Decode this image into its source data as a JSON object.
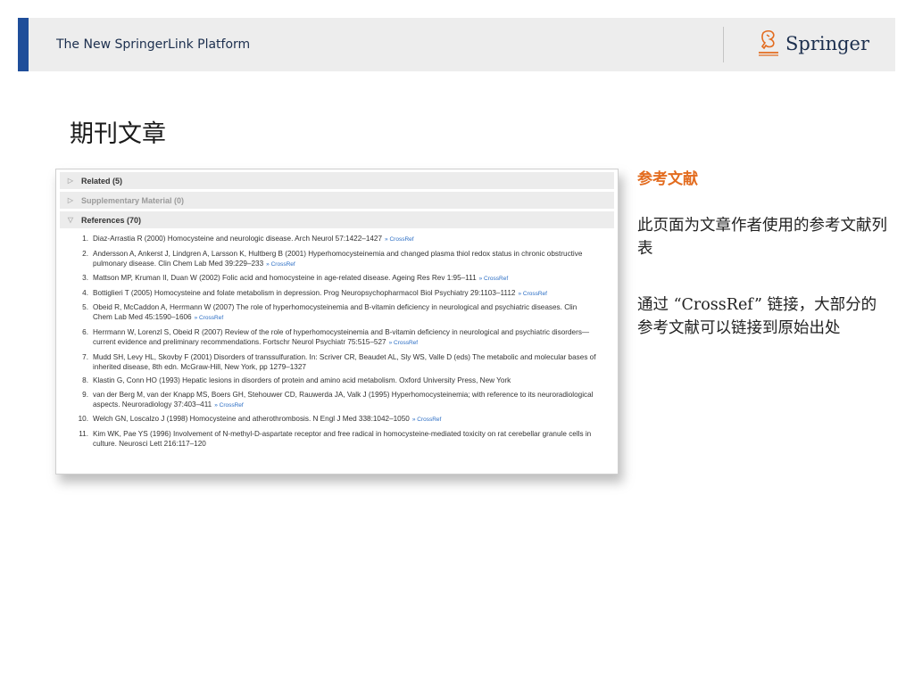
{
  "header": {
    "platform_title": "The New SpringerLink Platform",
    "brand_name": "Springer",
    "brand_icon": "springer-horse-icon",
    "accent_color": "#1f4e9a"
  },
  "page_title": "期刊文章",
  "article_panel": {
    "sections": [
      {
        "label": "Related (5)",
        "state": "collapsed"
      },
      {
        "label": "Supplementary Material (0)",
        "state": "collapsed-disabled"
      },
      {
        "label": "References (70)",
        "state": "expanded"
      }
    ],
    "crossref_label": "» CrossRef",
    "references": [
      {
        "num": "1.",
        "text": "Diaz-Arrastia R (2000) Homocysteine and neurologic disease. Arch Neurol 57:1422–1427",
        "crossref": true
      },
      {
        "num": "2.",
        "text": "Andersson A, Ankerst J, Lindgren A, Larsson K, Hultberg B (2001) Hyperhomocysteinemia and changed plasma thiol redox status in chronic obstructive pulmonary disease. Clin Chem Lab Med 39:229–233",
        "crossref": true
      },
      {
        "num": "3.",
        "text": "Mattson MP, Kruman II, Duan W (2002) Folic acid and homocysteine in age-related disease. Ageing Res Rev 1:95–111",
        "crossref": true
      },
      {
        "num": "4.",
        "text": "Bottiglieri T (2005) Homocysteine and folate metabolism in depression. Prog Neuropsychopharmacol Biol Psychiatry 29:1103–1112",
        "crossref": true
      },
      {
        "num": "5.",
        "text": "Obeid R, McCaddon A, Herrmann W (2007) The role of hyperhomocysteinemia and B-vitamin deficiency in neurological and psychiatric diseases. Clin Chem Lab Med 45:1590–1606",
        "crossref": true
      },
      {
        "num": "6.",
        "text": "Herrmann W, Lorenzl S, Obeid R (2007) Review of the role of hyperhomocysteinemia and B-vitamin deficiency in neurological and psychiatric disorders—current evidence and preliminary recommendations. Fortschr Neurol Psychiatr 75:515–527",
        "crossref": true
      },
      {
        "num": "7.",
        "text": "Mudd SH, Levy HL, Skovby F (2001) Disorders of transsulfuration. In: Scriver CR, Beaudet AL, Sly WS, Valle D (eds) The metabolic and molecular bases of inherited disease, 8th edn. McGraw-Hill, New York, pp 1279–1327",
        "crossref": false
      },
      {
        "num": "8.",
        "text": "Klastin G, Conn HO (1993) Hepatic lesions in disorders of protein and amino acid metabolism. Oxford University Press, New York",
        "crossref": false
      },
      {
        "num": "9.",
        "text": "van der Berg M, van der Knapp MS, Boers GH, Stehouwer CD, Rauwerda JA, Valk J (1995) Hyperhomocysteinemia; with reference to its neuroradiological aspects. Neuroradiology 37:403–411",
        "crossref": true
      },
      {
        "num": "10.",
        "text": "Welch GN, Loscalzo J (1998) Homocysteine and atherothrombosis. N Engl J Med 338:1042–1050",
        "crossref": true
      },
      {
        "num": "11.",
        "text": "Kim WK, Pae YS (1996) Involvement of N-methyl-D-aspartate receptor and free radical in homocysteine-mediated toxicity on rat cerebellar granule cells in culture. Neurosci Lett 216:117–120",
        "crossref": false
      }
    ]
  },
  "side_notes": {
    "heading": "参考文献",
    "heading_color": "#e36c1f",
    "paragraph1": "此页面为文章作者使用的参考文献列表",
    "paragraph2": "通过 “CrossRef” 链接，大部分的参考文献可以链接到原始出处"
  }
}
